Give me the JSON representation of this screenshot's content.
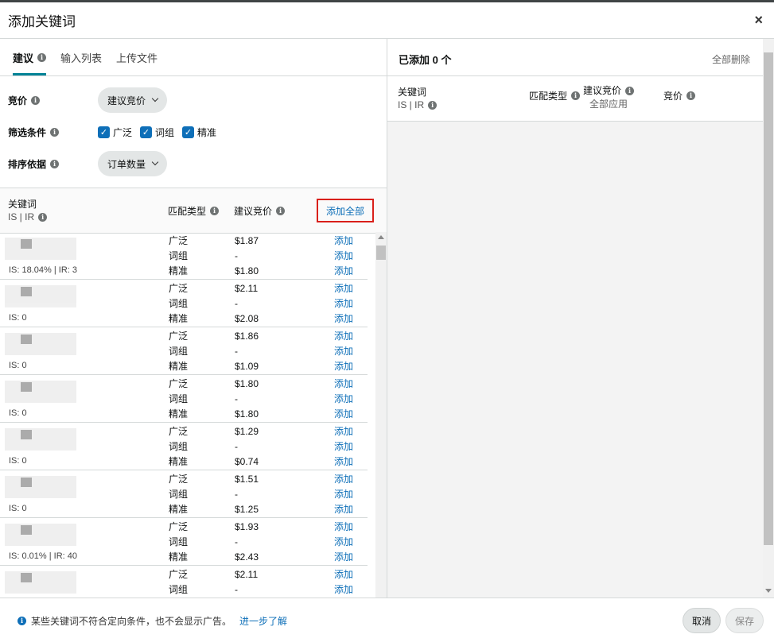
{
  "modal": {
    "title": "添加关键词",
    "close": "×"
  },
  "tabs": [
    {
      "label": "建议"
    },
    {
      "label": "输入列表"
    },
    {
      "label": "上传文件"
    }
  ],
  "filters": {
    "bid_label": "竞价",
    "bid_value": "建议竞价",
    "filter_label": "筛选条件",
    "checks": [
      "广泛",
      "词组",
      "精准"
    ],
    "sort_label": "排序依据",
    "sort_value": "订单数量"
  },
  "table": {
    "col_keyword": "关键词",
    "col_keyword_sub": "IS | IR",
    "col_match": "匹配类型",
    "col_bid": "建议竞价",
    "add_all": "添加全部",
    "add_label": "添加"
  },
  "rows": [
    {
      "stat": "IS: 18.04% | IR: 3",
      "matches": [
        "广泛",
        "词组",
        "精准"
      ],
      "bids": [
        "$1.87",
        "-",
        "$1.80"
      ]
    },
    {
      "stat": "IS: 0",
      "matches": [
        "广泛",
        "词组",
        "精准"
      ],
      "bids": [
        "$2.11",
        "-",
        "$2.08"
      ]
    },
    {
      "stat": "IS: 0",
      "matches": [
        "广泛",
        "词组",
        "精准"
      ],
      "bids": [
        "$1.86",
        "-",
        "$1.09"
      ]
    },
    {
      "stat": "IS: 0",
      "matches": [
        "广泛",
        "词组",
        "精准"
      ],
      "bids": [
        "$1.80",
        "-",
        "$1.80"
      ]
    },
    {
      "stat": "IS: 0",
      "matches": [
        "广泛",
        "词组",
        "精准"
      ],
      "bids": [
        "$1.29",
        "-",
        "$0.74"
      ]
    },
    {
      "stat": "IS: 0",
      "matches": [
        "广泛",
        "词组",
        "精准"
      ],
      "bids": [
        "$1.51",
        "-",
        "$1.25"
      ]
    },
    {
      "stat": "IS: 0.01% | IR: 40",
      "matches": [
        "广泛",
        "词组",
        "精准"
      ],
      "bids": [
        "$1.93",
        "-",
        "$2.43"
      ]
    },
    {
      "stat": "",
      "matches": [
        "广泛",
        "词组"
      ],
      "bids": [
        "$2.11",
        "-"
      ]
    }
  ],
  "right": {
    "title": "已添加 0 个",
    "remove_all": "全部删除",
    "col_keyword": "关键词",
    "col_keyword_sub": "IS | IR",
    "col_match": "匹配类型",
    "col_suggested": "建议竞价",
    "apply_all": "全部应用",
    "col_bid": "竞价"
  },
  "footer": {
    "note": "某些关键词不符合定向条件，也不会显示广告。",
    "learn_more": "进一步了解",
    "cancel": "取消",
    "save": "保存"
  }
}
